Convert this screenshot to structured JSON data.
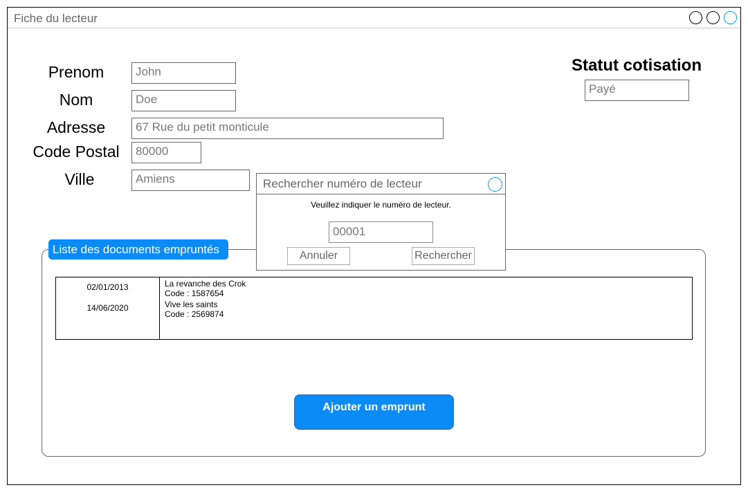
{
  "window": {
    "title": "Fiche du lecteur"
  },
  "form": {
    "prenom": {
      "label": "Prenom",
      "value": "John"
    },
    "nom": {
      "label": "Nom",
      "value": "Doe"
    },
    "adresse": {
      "label": "Adresse",
      "value": "67 Rue du petit monticule"
    },
    "code_postal": {
      "label": "Code Postal",
      "value": "80000"
    },
    "ville": {
      "label": "Ville",
      "value": "Amiens"
    }
  },
  "cotisation": {
    "heading": "Statut cotisation",
    "value": "Payé"
  },
  "documents": {
    "tab_label": "Liste des documents empruntés",
    "rows": [
      {
        "date": "02/01/2013",
        "title": "La revanche des Crok",
        "code": "Code : 1587654"
      },
      {
        "date": "14/06/2020",
        "title": "Vive les saints",
        "code": "Code : 2569874"
      }
    ],
    "add_button": "Ajouter un emprunt"
  },
  "dialog": {
    "title": "Rechercher numéro de lecteur",
    "message": "Veuillez indiquer le numéro de lecteur.",
    "input_value": "00001",
    "cancel_label": "Annuler",
    "search_label": "Rechercher"
  }
}
